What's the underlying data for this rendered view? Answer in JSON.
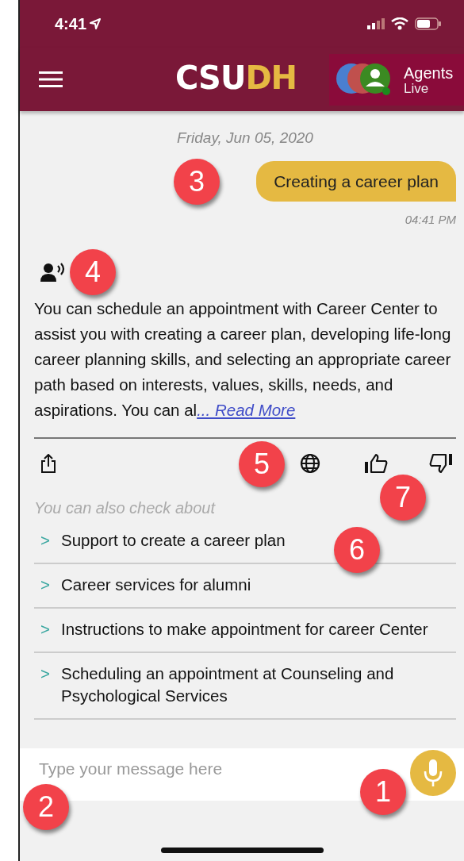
{
  "status_bar": {
    "time": "4:41"
  },
  "header": {
    "logo_left": "CSU",
    "logo_right": "DH",
    "agents_title": "Agents",
    "agents_status": "Live"
  },
  "chat": {
    "date": "Friday, Jun 05, 2020",
    "user_message": {
      "text": "Creating a career plan",
      "time": "04:41 PM"
    },
    "bot_message": {
      "text": "You can schedule an appointment with Career Center to assist you with creating a career plan, developing life-long career planning skills, and selecting an appropriate career path based on interests, values, skills, needs, and aspirations. You can al",
      "more_link": "... Read More"
    },
    "suggestions_title": "You can also check about",
    "suggestions": [
      {
        "marker": ">",
        "text": "Support to create a career plan"
      },
      {
        "marker": ">",
        "text": "Career services for alumni"
      },
      {
        "marker": ">",
        "text": "Instructions to make appointment for career Center"
      },
      {
        "marker": ">",
        "text": "Scheduling an appointment at Counseling and Psychological Services"
      }
    ]
  },
  "composer": {
    "placeholder": "Type your message here"
  },
  "callouts": [
    {
      "label": "1"
    },
    {
      "label": "2"
    },
    {
      "label": "3"
    },
    {
      "label": "4"
    },
    {
      "label": "5"
    },
    {
      "label": "6"
    },
    {
      "label": "7"
    }
  ]
}
